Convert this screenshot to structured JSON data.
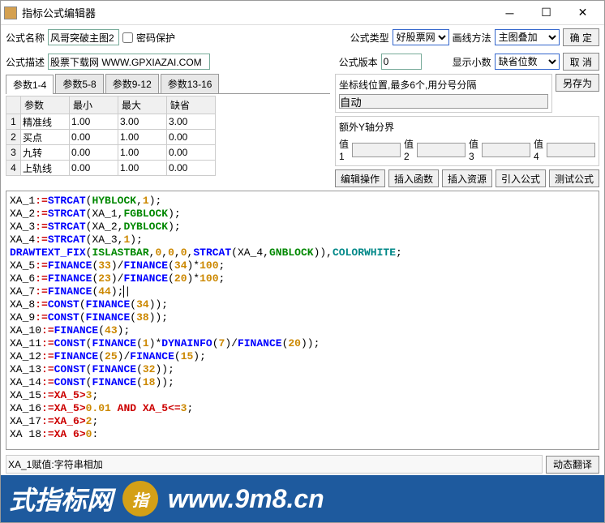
{
  "window": {
    "title": "指标公式编辑器"
  },
  "labels": {
    "name": "公式名称",
    "pwd": "密码保护",
    "type": "公式类型",
    "drawmethod": "画线方法",
    "desc": "公式描述",
    "version": "公式版本",
    "decimals": "显示小数",
    "ok": "确  定",
    "cancel": "取  消",
    "saveas": "另存为"
  },
  "fields": {
    "name": "风哥突破主图2",
    "desc": "股票下载网 WWW.GPXIAZAI.COM",
    "version": "0",
    "type": "好股票网",
    "drawmethod": "主图叠加",
    "decimals": "缺省位数"
  },
  "tabs": [
    "参数1-4",
    "参数5-8",
    "参数9-12",
    "参数13-16"
  ],
  "paramHeaders": [
    "",
    "参数",
    "最小",
    "最大",
    "缺省"
  ],
  "params": [
    {
      "n": "1",
      "name": "精准线",
      "min": "1.00",
      "max": "3.00",
      "def": "3.00"
    },
    {
      "n": "2",
      "name": "买点",
      "min": "0.00",
      "max": "1.00",
      "def": "0.00"
    },
    {
      "n": "3",
      "name": "九转",
      "min": "0.00",
      "max": "1.00",
      "def": "0.00"
    },
    {
      "n": "4",
      "name": "上轨线",
      "min": "0.00",
      "max": "1.00",
      "def": "0.00"
    }
  ],
  "coord": {
    "label": "坐标线位置,最多6个,用分号分隔",
    "auto": "自动"
  },
  "axis": {
    "label": "额外Y轴分界",
    "v1": "值1",
    "v2": "值2",
    "v3": "值3",
    "v4": "值4"
  },
  "btns": {
    "edit": "编辑操作",
    "insfn": "插入函数",
    "insres": "插入资源",
    "import": "引入公式",
    "test": "测试公式",
    "dyntrans": "动态翻译"
  },
  "status": "XA_1赋值:字符串相加",
  "footer": {
    "left": "式指标网",
    "url": "www.9m8.cn"
  },
  "code": [
    [
      [
        "XA_1",
        0
      ],
      [
        ":=",
        1
      ],
      [
        "STRCAT",
        2
      ],
      [
        "(",
        0
      ],
      [
        "HYBLOCK",
        3
      ],
      [
        ",",
        0
      ],
      [
        "1",
        4
      ],
      [
        ");",
        0
      ]
    ],
    [
      [
        "XA_2",
        0
      ],
      [
        ":=",
        1
      ],
      [
        "STRCAT",
        2
      ],
      [
        "(XA_1,",
        0
      ],
      [
        "FGBLOCK",
        3
      ],
      [
        ");",
        0
      ]
    ],
    [
      [
        "XA_3",
        0
      ],
      [
        ":=",
        1
      ],
      [
        "STRCAT",
        2
      ],
      [
        "(XA_2,",
        0
      ],
      [
        "DYBLOCK",
        3
      ],
      [
        ");",
        0
      ]
    ],
    [
      [
        "XA_4",
        0
      ],
      [
        ":=",
        1
      ],
      [
        "STRCAT",
        2
      ],
      [
        "(XA_3,",
        0
      ],
      [
        "1",
        4
      ],
      [
        ");",
        0
      ]
    ],
    [
      [
        "DRAWTEXT_FIX",
        2
      ],
      [
        "(",
        0
      ],
      [
        "ISLASTBAR",
        3
      ],
      [
        ",",
        0
      ],
      [
        "0",
        4
      ],
      [
        ",",
        0
      ],
      [
        "0",
        4
      ],
      [
        ",",
        0
      ],
      [
        "0",
        4
      ],
      [
        ",",
        0
      ],
      [
        "STRCAT",
        2
      ],
      [
        "(XA_4,",
        0
      ],
      [
        "GNBLOCK",
        3
      ],
      [
        ")),",
        0
      ],
      [
        "COLORWHITE",
        5
      ],
      [
        ";",
        0
      ]
    ],
    [
      [
        "XA_5",
        0
      ],
      [
        ":=",
        1
      ],
      [
        "FINANCE",
        2
      ],
      [
        "(",
        0
      ],
      [
        "33",
        4
      ],
      [
        ")/",
        0
      ],
      [
        "FINANCE",
        2
      ],
      [
        "(",
        0
      ],
      [
        "34",
        4
      ],
      [
        ")*",
        0
      ],
      [
        "100",
        4
      ],
      [
        ";",
        0
      ]
    ],
    [
      [
        "XA_6",
        0
      ],
      [
        ":=",
        1
      ],
      [
        "FINANCE",
        2
      ],
      [
        "(",
        0
      ],
      [
        "23",
        4
      ],
      [
        ")/",
        0
      ],
      [
        "FINANCE",
        2
      ],
      [
        "(",
        0
      ],
      [
        "20",
        4
      ],
      [
        ")*",
        0
      ],
      [
        "100",
        4
      ],
      [
        ";",
        0
      ]
    ],
    [
      [
        "XA_7",
        0
      ],
      [
        ":=",
        1
      ],
      [
        "FINANCE",
        2
      ],
      [
        "(",
        0
      ],
      [
        "44",
        4
      ],
      [
        ");",
        0
      ],
      [
        "|",
        6
      ]
    ],
    [
      [
        "XA_8",
        0
      ],
      [
        ":=",
        1
      ],
      [
        "CONST",
        2
      ],
      [
        "(",
        0
      ],
      [
        "FINANCE",
        2
      ],
      [
        "(",
        0
      ],
      [
        "34",
        4
      ],
      [
        "));",
        0
      ]
    ],
    [
      [
        "XA_9",
        0
      ],
      [
        ":=",
        1
      ],
      [
        "CONST",
        2
      ],
      [
        "(",
        0
      ],
      [
        "FINANCE",
        2
      ],
      [
        "(",
        0
      ],
      [
        "38",
        4
      ],
      [
        "));",
        0
      ]
    ],
    [
      [
        "XA_10",
        0
      ],
      [
        ":=",
        1
      ],
      [
        "FINANCE",
        2
      ],
      [
        "(",
        0
      ],
      [
        "43",
        4
      ],
      [
        ");",
        0
      ]
    ],
    [
      [
        "XA_11",
        0
      ],
      [
        ":=",
        1
      ],
      [
        "CONST",
        2
      ],
      [
        "(",
        0
      ],
      [
        "FINANCE",
        2
      ],
      [
        "(",
        0
      ],
      [
        "1",
        4
      ],
      [
        ")*",
        0
      ],
      [
        "DYNAINFO",
        2
      ],
      [
        "(",
        0
      ],
      [
        "7",
        4
      ],
      [
        ")/",
        0
      ],
      [
        "FINANCE",
        2
      ],
      [
        "(",
        0
      ],
      [
        "20",
        4
      ],
      [
        "));",
        0
      ]
    ],
    [
      [
        "XA_12",
        0
      ],
      [
        ":=",
        1
      ],
      [
        "FINANCE",
        2
      ],
      [
        "(",
        0
      ],
      [
        "25",
        4
      ],
      [
        ")/",
        0
      ],
      [
        "FINANCE",
        2
      ],
      [
        "(",
        0
      ],
      [
        "15",
        4
      ],
      [
        ");",
        0
      ]
    ],
    [
      [
        "XA_13",
        0
      ],
      [
        ":=",
        1
      ],
      [
        "CONST",
        2
      ],
      [
        "(",
        0
      ],
      [
        "FINANCE",
        2
      ],
      [
        "(",
        0
      ],
      [
        "32",
        4
      ],
      [
        "));",
        0
      ]
    ],
    [
      [
        "XA_14",
        0
      ],
      [
        ":=",
        1
      ],
      [
        "CONST",
        2
      ],
      [
        "(",
        0
      ],
      [
        "FINANCE",
        2
      ],
      [
        "(",
        0
      ],
      [
        "18",
        4
      ],
      [
        "));",
        0
      ]
    ],
    [
      [
        "XA_15",
        0
      ],
      [
        ":=XA_5>",
        1
      ],
      [
        "3",
        4
      ],
      [
        ";",
        0
      ]
    ],
    [
      [
        "XA_16",
        0
      ],
      [
        ":=XA_5>",
        1
      ],
      [
        "0.01",
        4
      ],
      [
        " ",
        0
      ],
      [
        "AND",
        1
      ],
      [
        " XA_5<=",
        1
      ],
      [
        "3",
        4
      ],
      [
        ";",
        0
      ]
    ],
    [
      [
        "XA_17",
        0
      ],
      [
        ":=XA_6>",
        1
      ],
      [
        "2",
        4
      ],
      [
        ";",
        0
      ]
    ],
    [
      [
        "XA 18",
        0
      ],
      [
        ":=XA 6>",
        1
      ],
      [
        "0",
        4
      ],
      [
        ":",
        0
      ]
    ]
  ],
  "codeClasses": [
    "kw-black",
    "kw-red",
    "kw-blue",
    "kw-green",
    "kw-orange",
    "kw-teal",
    "cursor"
  ]
}
